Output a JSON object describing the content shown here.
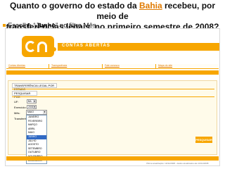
{
  "question": {
    "line1_before": "Quanto o governo do estado da ",
    "state": "Bahia",
    "line1_after": " recebeu, por meio de",
    "line2": "transferências legais, no primeiro semestre de 2008?"
  },
  "instruction": {
    "prefix": "Escolha “",
    "month": "Junho",
    "middle": "” no filtro ",
    "filter": "Mês",
    "suffix": "."
  },
  "app": {
    "brand": "CONTAS ABERTAS",
    "accent_color": "#f7a600",
    "nav": [
      "Contas Abertas",
      "Transparência",
      "Fale conosco",
      "Mapa do site"
    ],
    "section_title": "TRANSFERÊNCIA LEGAL POR ESTADO",
    "filter_title": "PESQUISAR POR",
    "fields": {
      "uf_label": "UF:",
      "uf_value": "BA",
      "year_label": "Exercício:",
      "year_value": "2008",
      "month_label": "Mês:",
      "month_value": "MAIO",
      "transfer_label": "Transferência:"
    },
    "months": [
      "JANEIRO",
      "FEVEREIRO",
      "MARÇO",
      "ABRIL",
      "MAIO",
      "JUNHO",
      "JULHO",
      "AGOSTO",
      "SETEMBRO",
      "OUTUBRO",
      "NOVEMBRO",
      "DEZEMBRO"
    ],
    "selected_month_index": 5,
    "search_button": "PESQUISAR",
    "footer": "Última atualização: 10/11/2008 - dados atualizados até 10/11/2008"
  }
}
